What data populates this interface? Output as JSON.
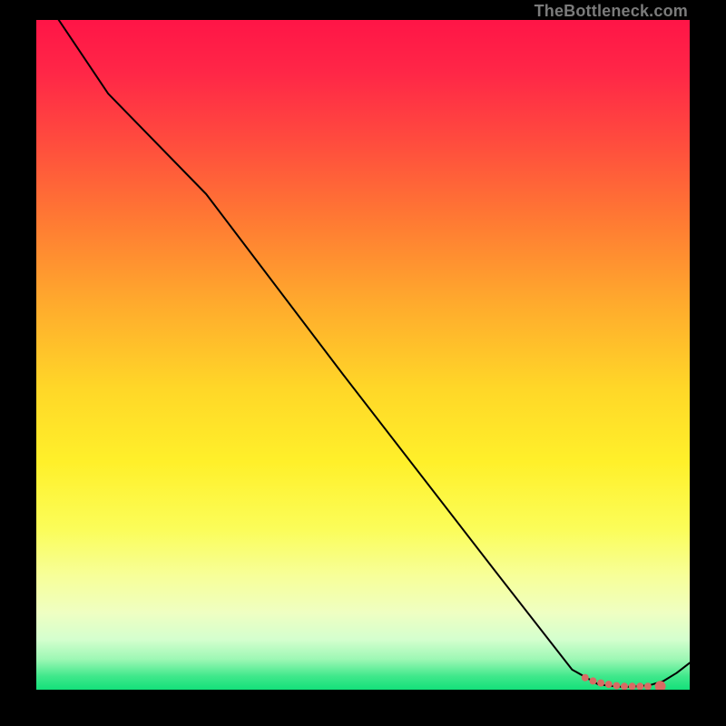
{
  "watermark": "TheBottleneck.com",
  "chart_data": {
    "type": "line",
    "title": "",
    "xlabel": "",
    "ylabel": "",
    "xlim": [
      0,
      100
    ],
    "ylim": [
      0,
      100
    ],
    "background_gradient": {
      "top": "#ff1846",
      "mid_upper": "#ff9a2b",
      "mid": "#ffe82a",
      "mid_lower": "#faff9a",
      "lower_band": "#e8ffc8",
      "bottom": "#17e87a"
    },
    "series": [
      {
        "name": "curve",
        "color": "#000000",
        "x": [
          0,
          11,
          26,
          47,
          70,
          82,
          86,
          88.5,
          90,
          92,
          94,
          96,
          98,
          100
        ],
        "values": [
          105,
          89,
          74,
          47,
          18,
          3,
          0.8,
          0.5,
          0.4,
          0.5,
          0.7,
          1.3,
          2.5,
          4.0
        ]
      },
      {
        "name": "dots",
        "color": "#d86b63",
        "type": "scatter",
        "x": [
          84,
          85.2,
          86.4,
          87.6,
          88.8,
          90,
          91.2,
          92.4,
          93.6,
          95.5
        ],
        "values": [
          1.8,
          1.3,
          1.0,
          0.8,
          0.6,
          0.5,
          0.5,
          0.5,
          0.5,
          0.5
        ],
        "radius": [
          4,
          4,
          4,
          4,
          4,
          4,
          4,
          4,
          4,
          6
        ]
      }
    ]
  }
}
